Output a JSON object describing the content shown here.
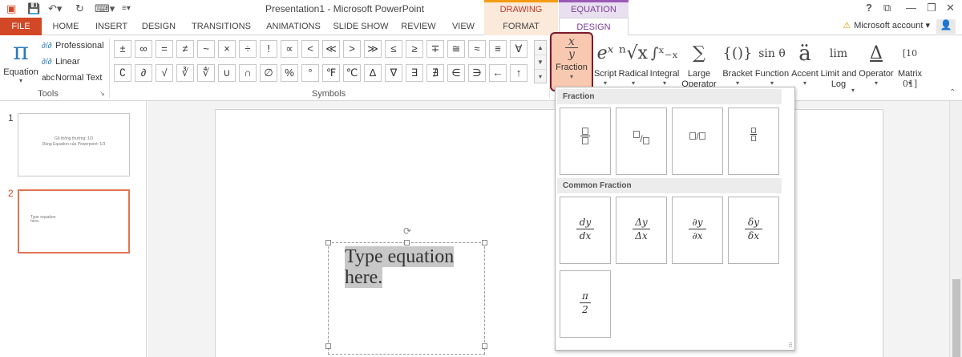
{
  "title_bar": {
    "title": "Presentation1 - Microsoft PowerPoint",
    "contextual_groups": {
      "drawing_tools": "DRAWING TOOLS",
      "equation_tools": "EQUATION TOOLS"
    },
    "help": "?"
  },
  "tabs": [
    "FILE",
    "HOME",
    "INSERT",
    "DESIGN",
    "TRANSITIONS",
    "ANIMATIONS",
    "SLIDE SHOW",
    "REVIEW",
    "VIEW",
    "FORMAT",
    "DESIGN"
  ],
  "account": "Microsoft account",
  "ribbon": {
    "tools": {
      "equation_label": "Equation",
      "items": [
        "Professional",
        "Linear",
        "Normal Text"
      ],
      "group_label": "Tools"
    },
    "symbols": {
      "group_label": "Symbols",
      "row1": [
        "±",
        "∞",
        "=",
        "≠",
        "~",
        "×",
        "÷",
        "!",
        "∝",
        "<",
        "≪",
        ">",
        "≫",
        "≤",
        "≥",
        "∓",
        "≅",
        "≈",
        "≡",
        "∀"
      ],
      "row2": [
        "∁",
        "∂",
        "√",
        "∛",
        "∜",
        "∪",
        "∩",
        "∅",
        "%",
        "°",
        "℉",
        "℃",
        "∆",
        "∇",
        "∃",
        "∄",
        "∈",
        "∋",
        "←",
        "↑"
      ]
    },
    "structures": [
      {
        "id": "fraction",
        "glyph_num": "x",
        "glyph_den": "y",
        "label": "Fraction"
      },
      {
        "id": "script",
        "glyph": "eˣ",
        "label": "Script"
      },
      {
        "id": "radical",
        "glyph": "ⁿ√x",
        "label": "Radical"
      },
      {
        "id": "integral",
        "glyph": "∫ˣ₋ₓ",
        "label": "Integral"
      },
      {
        "id": "large-operator",
        "glyph": "∑",
        "label": "Large",
        "label2": "Operator"
      },
      {
        "id": "bracket",
        "glyph": "{()}",
        "label": "Bracket"
      },
      {
        "id": "function",
        "glyph": "sin θ",
        "label": "Function"
      },
      {
        "id": "accent",
        "glyph": "ä",
        "label": "Accent"
      },
      {
        "id": "limit-log",
        "glyph": "lim",
        "label": "Limit and",
        "label2": "Log"
      },
      {
        "id": "operator",
        "glyph": "Δ",
        "label": "Operator"
      },
      {
        "id": "matrix",
        "glyph": "[10 01]",
        "label": "Matrix"
      }
    ]
  },
  "slides": [
    {
      "number": "1",
      "lines": [
        "Gõ thông thường: 1/3",
        "Dùng Equation của Powerpoint: 1/3"
      ]
    },
    {
      "number": "2",
      "lines": [
        "Type equation",
        "here."
      ]
    }
  ],
  "equation_placeholder": [
    "Type equation",
    "here."
  ],
  "gallery": {
    "section1": "Fraction",
    "section2": "Common Fraction",
    "common": [
      {
        "num": "dy",
        "den": "dx"
      },
      {
        "num": "Δy",
        "den": "Δx"
      },
      {
        "num": "∂y",
        "den": "∂x"
      },
      {
        "num": "δy",
        "den": "δx"
      },
      {
        "num": "π",
        "den": "2"
      }
    ]
  },
  "colors": {
    "file_tab": "#d24726",
    "accent_blue": "#2b7bb9",
    "fraction_highlight": "#f8c9b0",
    "fraction_border": "#7b1a2b",
    "selected_slide": "#e07550"
  }
}
